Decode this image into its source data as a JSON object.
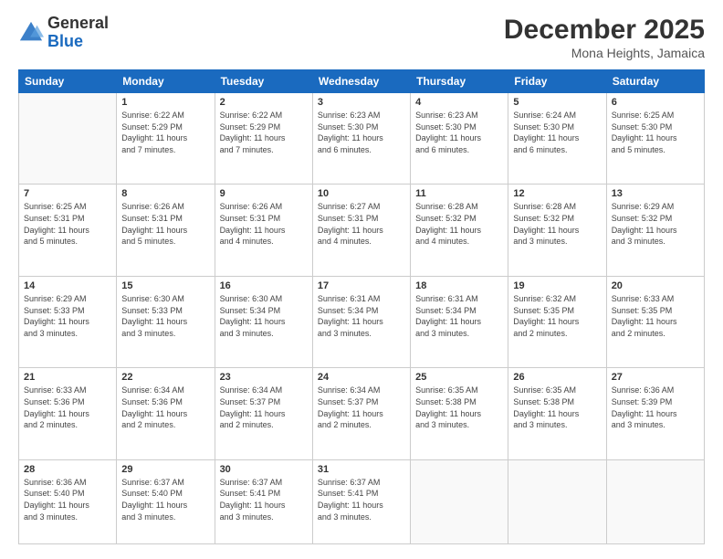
{
  "logo": {
    "line1": "General",
    "line2": "Blue"
  },
  "header": {
    "month_year": "December 2025",
    "location": "Mona Heights, Jamaica"
  },
  "days_of_week": [
    "Sunday",
    "Monday",
    "Tuesday",
    "Wednesday",
    "Thursday",
    "Friday",
    "Saturday"
  ],
  "weeks": [
    [
      {
        "day": "",
        "info": ""
      },
      {
        "day": "1",
        "info": "Sunrise: 6:22 AM\nSunset: 5:29 PM\nDaylight: 11 hours\nand 7 minutes."
      },
      {
        "day": "2",
        "info": "Sunrise: 6:22 AM\nSunset: 5:29 PM\nDaylight: 11 hours\nand 7 minutes."
      },
      {
        "day": "3",
        "info": "Sunrise: 6:23 AM\nSunset: 5:30 PM\nDaylight: 11 hours\nand 6 minutes."
      },
      {
        "day": "4",
        "info": "Sunrise: 6:23 AM\nSunset: 5:30 PM\nDaylight: 11 hours\nand 6 minutes."
      },
      {
        "day": "5",
        "info": "Sunrise: 6:24 AM\nSunset: 5:30 PM\nDaylight: 11 hours\nand 6 minutes."
      },
      {
        "day": "6",
        "info": "Sunrise: 6:25 AM\nSunset: 5:30 PM\nDaylight: 11 hours\nand 5 minutes."
      }
    ],
    [
      {
        "day": "7",
        "info": "Sunrise: 6:25 AM\nSunset: 5:31 PM\nDaylight: 11 hours\nand 5 minutes."
      },
      {
        "day": "8",
        "info": "Sunrise: 6:26 AM\nSunset: 5:31 PM\nDaylight: 11 hours\nand 5 minutes."
      },
      {
        "day": "9",
        "info": "Sunrise: 6:26 AM\nSunset: 5:31 PM\nDaylight: 11 hours\nand 4 minutes."
      },
      {
        "day": "10",
        "info": "Sunrise: 6:27 AM\nSunset: 5:31 PM\nDaylight: 11 hours\nand 4 minutes."
      },
      {
        "day": "11",
        "info": "Sunrise: 6:28 AM\nSunset: 5:32 PM\nDaylight: 11 hours\nand 4 minutes."
      },
      {
        "day": "12",
        "info": "Sunrise: 6:28 AM\nSunset: 5:32 PM\nDaylight: 11 hours\nand 3 minutes."
      },
      {
        "day": "13",
        "info": "Sunrise: 6:29 AM\nSunset: 5:32 PM\nDaylight: 11 hours\nand 3 minutes."
      }
    ],
    [
      {
        "day": "14",
        "info": "Sunrise: 6:29 AM\nSunset: 5:33 PM\nDaylight: 11 hours\nand 3 minutes."
      },
      {
        "day": "15",
        "info": "Sunrise: 6:30 AM\nSunset: 5:33 PM\nDaylight: 11 hours\nand 3 minutes."
      },
      {
        "day": "16",
        "info": "Sunrise: 6:30 AM\nSunset: 5:34 PM\nDaylight: 11 hours\nand 3 minutes."
      },
      {
        "day": "17",
        "info": "Sunrise: 6:31 AM\nSunset: 5:34 PM\nDaylight: 11 hours\nand 3 minutes."
      },
      {
        "day": "18",
        "info": "Sunrise: 6:31 AM\nSunset: 5:34 PM\nDaylight: 11 hours\nand 3 minutes."
      },
      {
        "day": "19",
        "info": "Sunrise: 6:32 AM\nSunset: 5:35 PM\nDaylight: 11 hours\nand 2 minutes."
      },
      {
        "day": "20",
        "info": "Sunrise: 6:33 AM\nSunset: 5:35 PM\nDaylight: 11 hours\nand 2 minutes."
      }
    ],
    [
      {
        "day": "21",
        "info": "Sunrise: 6:33 AM\nSunset: 5:36 PM\nDaylight: 11 hours\nand 2 minutes."
      },
      {
        "day": "22",
        "info": "Sunrise: 6:34 AM\nSunset: 5:36 PM\nDaylight: 11 hours\nand 2 minutes."
      },
      {
        "day": "23",
        "info": "Sunrise: 6:34 AM\nSunset: 5:37 PM\nDaylight: 11 hours\nand 2 minutes."
      },
      {
        "day": "24",
        "info": "Sunrise: 6:34 AM\nSunset: 5:37 PM\nDaylight: 11 hours\nand 2 minutes."
      },
      {
        "day": "25",
        "info": "Sunrise: 6:35 AM\nSunset: 5:38 PM\nDaylight: 11 hours\nand 3 minutes."
      },
      {
        "day": "26",
        "info": "Sunrise: 6:35 AM\nSunset: 5:38 PM\nDaylight: 11 hours\nand 3 minutes."
      },
      {
        "day": "27",
        "info": "Sunrise: 6:36 AM\nSunset: 5:39 PM\nDaylight: 11 hours\nand 3 minutes."
      }
    ],
    [
      {
        "day": "28",
        "info": "Sunrise: 6:36 AM\nSunset: 5:40 PM\nDaylight: 11 hours\nand 3 minutes."
      },
      {
        "day": "29",
        "info": "Sunrise: 6:37 AM\nSunset: 5:40 PM\nDaylight: 11 hours\nand 3 minutes."
      },
      {
        "day": "30",
        "info": "Sunrise: 6:37 AM\nSunset: 5:41 PM\nDaylight: 11 hours\nand 3 minutes."
      },
      {
        "day": "31",
        "info": "Sunrise: 6:37 AM\nSunset: 5:41 PM\nDaylight: 11 hours\nand 3 minutes."
      },
      {
        "day": "",
        "info": ""
      },
      {
        "day": "",
        "info": ""
      },
      {
        "day": "",
        "info": ""
      }
    ]
  ]
}
